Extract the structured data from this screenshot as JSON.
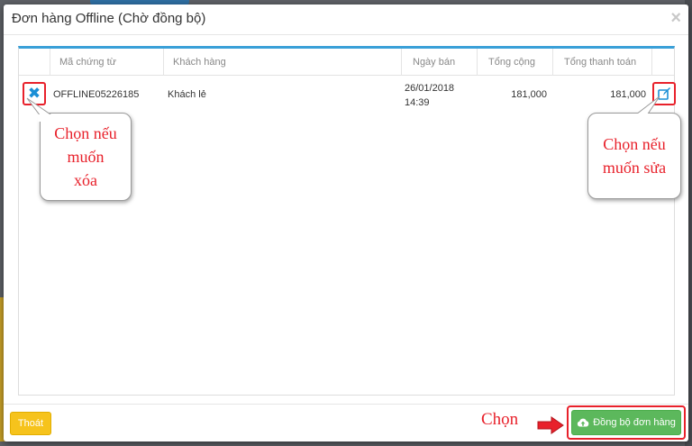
{
  "modal": {
    "title": "Đơn hàng Offline (Chờ đồng bộ)",
    "close_glyph": "×"
  },
  "table": {
    "headers": [
      "",
      "Mã chứng từ",
      "Khách hàng",
      "Ngày bán",
      "Tổng cộng",
      "Tổng thanh toán",
      ""
    ],
    "rows": [
      {
        "code": "OFFLINE05226185",
        "customer": "Khách lẻ",
        "date": "26/01/2018",
        "time": "14:39",
        "total": "181,000",
        "total_payment": "181,000"
      }
    ]
  },
  "icons": {
    "delete": "x-icon",
    "edit": "edit-icon",
    "sync": "cloud-upload-icon",
    "arrow": "arrow-right-icon"
  },
  "annotations": {
    "delete_callout": [
      "Chọn nếu",
      "muốn",
      "xóa"
    ],
    "edit_callout": [
      "Chọn nếu",
      "muốn sửa"
    ],
    "choose": "Chọn"
  },
  "footer": {
    "exit_label": "Thoát",
    "sync_label": "Đồng bộ đơn hàng"
  },
  "colors": {
    "accent": "#3aa0d8",
    "highlight_red": "#e8212b",
    "exit_yellow": "#f6c31c",
    "sync_green": "#5cb85c"
  }
}
